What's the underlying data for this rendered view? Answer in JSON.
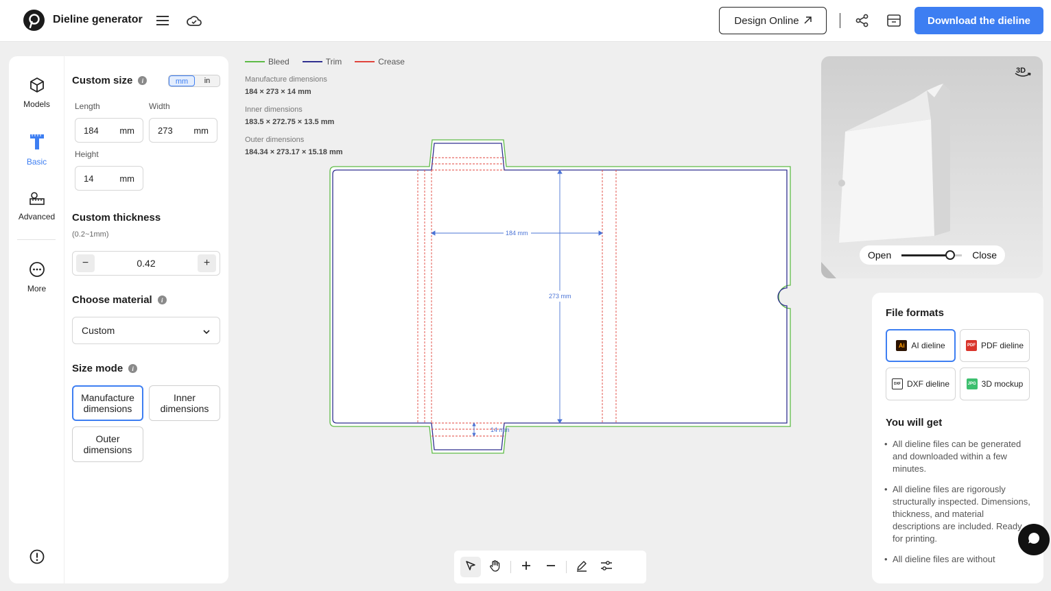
{
  "header": {
    "app_title": "Dieline generator",
    "design_online_label": "Design Online",
    "download_label": "Download the dieline"
  },
  "nav": {
    "models": "Models",
    "basic": "Basic",
    "advanced": "Advanced",
    "more": "More"
  },
  "size": {
    "title": "Custom size",
    "unit_mm": "mm",
    "unit_in": "in",
    "length_label": "Length",
    "length_value": "184",
    "width_label": "Width",
    "width_value": "273",
    "height_label": "Height",
    "height_value": "14",
    "unit": "mm"
  },
  "thickness": {
    "title": "Custom thickness",
    "hint": "(0.2~1mm)",
    "value": "0.42"
  },
  "material": {
    "title": "Choose material",
    "selected": "Custom"
  },
  "size_mode": {
    "title": "Size mode",
    "manufacture": "Manufacture dimensions",
    "inner": "Inner dimensions",
    "outer": "Outer dimensions"
  },
  "legend": {
    "bleed": "Bleed",
    "trim": "Trim",
    "crease": "Crease",
    "bleed_color": "#5dbb46",
    "trim_color": "#2f2f8f",
    "crease_color": "#e0433b"
  },
  "dimensions": {
    "manufacture_label": "Manufacture dimensions",
    "manufacture_value": "184 × 273 × 14 mm",
    "inner_label": "Inner dimensions",
    "inner_value": "183.5 × 272.75 × 13.5 mm",
    "outer_label": "Outer dimensions",
    "outer_value": "184.34 × 273.17 × 15.18 mm"
  },
  "dieline": {
    "length_annotation": "184 mm",
    "width_annotation": "273 mm",
    "height_annotation": "14 mm"
  },
  "preview": {
    "badge": "3D",
    "open_label": "Open",
    "close_label": "Close",
    "open_level": 0.8
  },
  "files": {
    "title": "File formats",
    "formats": [
      {
        "label": "AI dieline",
        "icon_text": "Ai"
      },
      {
        "label": "PDF dieline",
        "icon_text": "PDF"
      },
      {
        "label": "DXF dieline",
        "icon_text": "DXF"
      },
      {
        "label": "3D mockup",
        "icon_text": "JPG"
      }
    ],
    "you_get_title": "You will get",
    "benefits": [
      "All dieline files can be generated and downloaded within a few minutes.",
      "All dieline files are rigorously structurally inspected. Dimensions, thickness, and material descriptions are included. Ready for printing.",
      "All dieline files are without"
    ]
  },
  "colors": {
    "accent": "#3d7ef2"
  }
}
